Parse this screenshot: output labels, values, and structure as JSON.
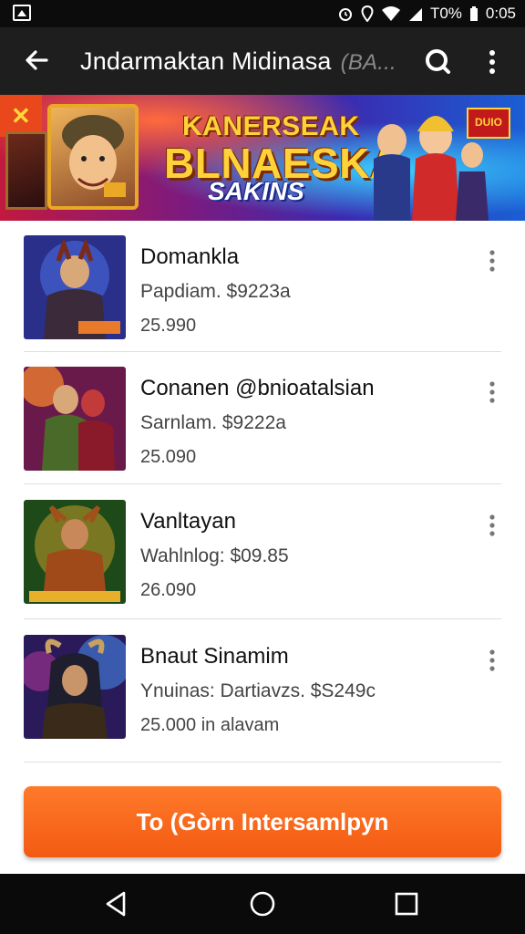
{
  "status_bar": {
    "battery_text": "T0%",
    "time": "0:05"
  },
  "app_bar": {
    "title": "Jndarmaktan Midinasa",
    "title_extra": "(BA..."
  },
  "banner": {
    "headline_1": "KANERSEAK",
    "headline_2": "BLNAESKA",
    "headline_3": "SAKINS",
    "badge_text": "DUIO"
  },
  "items": [
    {
      "name": "Domankla",
      "line2": "Papdiam.  $9223a",
      "line3": "25.990",
      "thumb_colors": [
        "#2a2f8a",
        "#e87a2a"
      ]
    },
    {
      "name": "Conanen @bnioatalsian",
      "line2": "Sarnlam.  $9222a",
      "line3": "25.090",
      "thumb_colors": [
        "#6a1a4a",
        "#ff8a2a"
      ]
    },
    {
      "name": "Vanltayan",
      "line2": "Wahlnlog:  $09.85",
      "line3": "26.090",
      "thumb_colors": [
        "#1e4a1a",
        "#e8b02a"
      ]
    },
    {
      "name": "Bnaut Sinamim",
      "line2": "Ynuinas:  Dartiavzs.  $S249c",
      "line3": "25.000  in alavam",
      "thumb_colors": [
        "#2a1a5a",
        "#4a9aff"
      ]
    }
  ],
  "cta": {
    "label": "To (Gòrn Intersamlpyn"
  },
  "colors": {
    "accent_orange": "#f25a12",
    "app_bar_bg": "#1e1e1e",
    "status_bar_bg": "#0c0c0c"
  }
}
